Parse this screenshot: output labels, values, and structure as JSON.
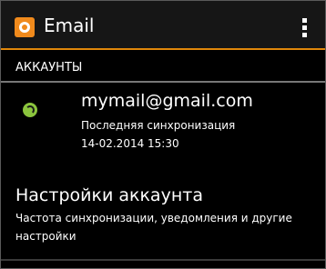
{
  "action_bar": {
    "app_icon": "settings-gear-icon",
    "title": "Email",
    "overflow_icon": "overflow-menu-icon"
  },
  "section": {
    "label": "АККАУНТЫ"
  },
  "account": {
    "sync_icon": "sync-icon",
    "email": "mymail@gmail.com",
    "sync_label": "Последняя синхронизация",
    "sync_time": "14-02.2014 15:30"
  },
  "settings": {
    "title": "Настройки аккаунта",
    "description": "Частота синхронизации, уведомления и другие настройки"
  },
  "colors": {
    "accent": "#e0870a",
    "sync_green": "#8bc43d",
    "background": "#000000"
  }
}
